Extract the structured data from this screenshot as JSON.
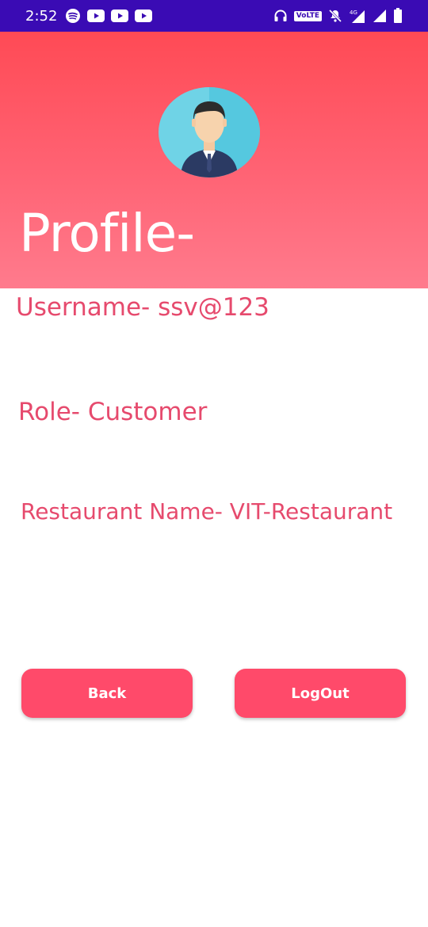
{
  "status_bar": {
    "time": "2:52",
    "left_icons": [
      "spotify-icon",
      "youtube-icon",
      "youtube-icon",
      "youtube-icon"
    ],
    "volte_label": "VoLTE",
    "network_label": "4G",
    "right_icons": [
      "headphones-icon",
      "volte-icon",
      "mute-icon",
      "signal-icon",
      "signal-icon",
      "battery-icon"
    ]
  },
  "header": {
    "title": "Profile-",
    "avatar_icon": "user-avatar-icon"
  },
  "profile": {
    "username_line": "Username- ssv@123",
    "role_line": "Role- Customer",
    "restaurant_line": "Restaurant Name- VIT-Restaurant"
  },
  "buttons": {
    "back_label": "Back",
    "logout_label": "LogOut"
  },
  "colors": {
    "status_bar": "#3a0bb4",
    "header_top": "#ff4a55",
    "header_bottom": "#ff7b8d",
    "text_accent": "#e64a6d",
    "button": "#ff4a6a"
  }
}
